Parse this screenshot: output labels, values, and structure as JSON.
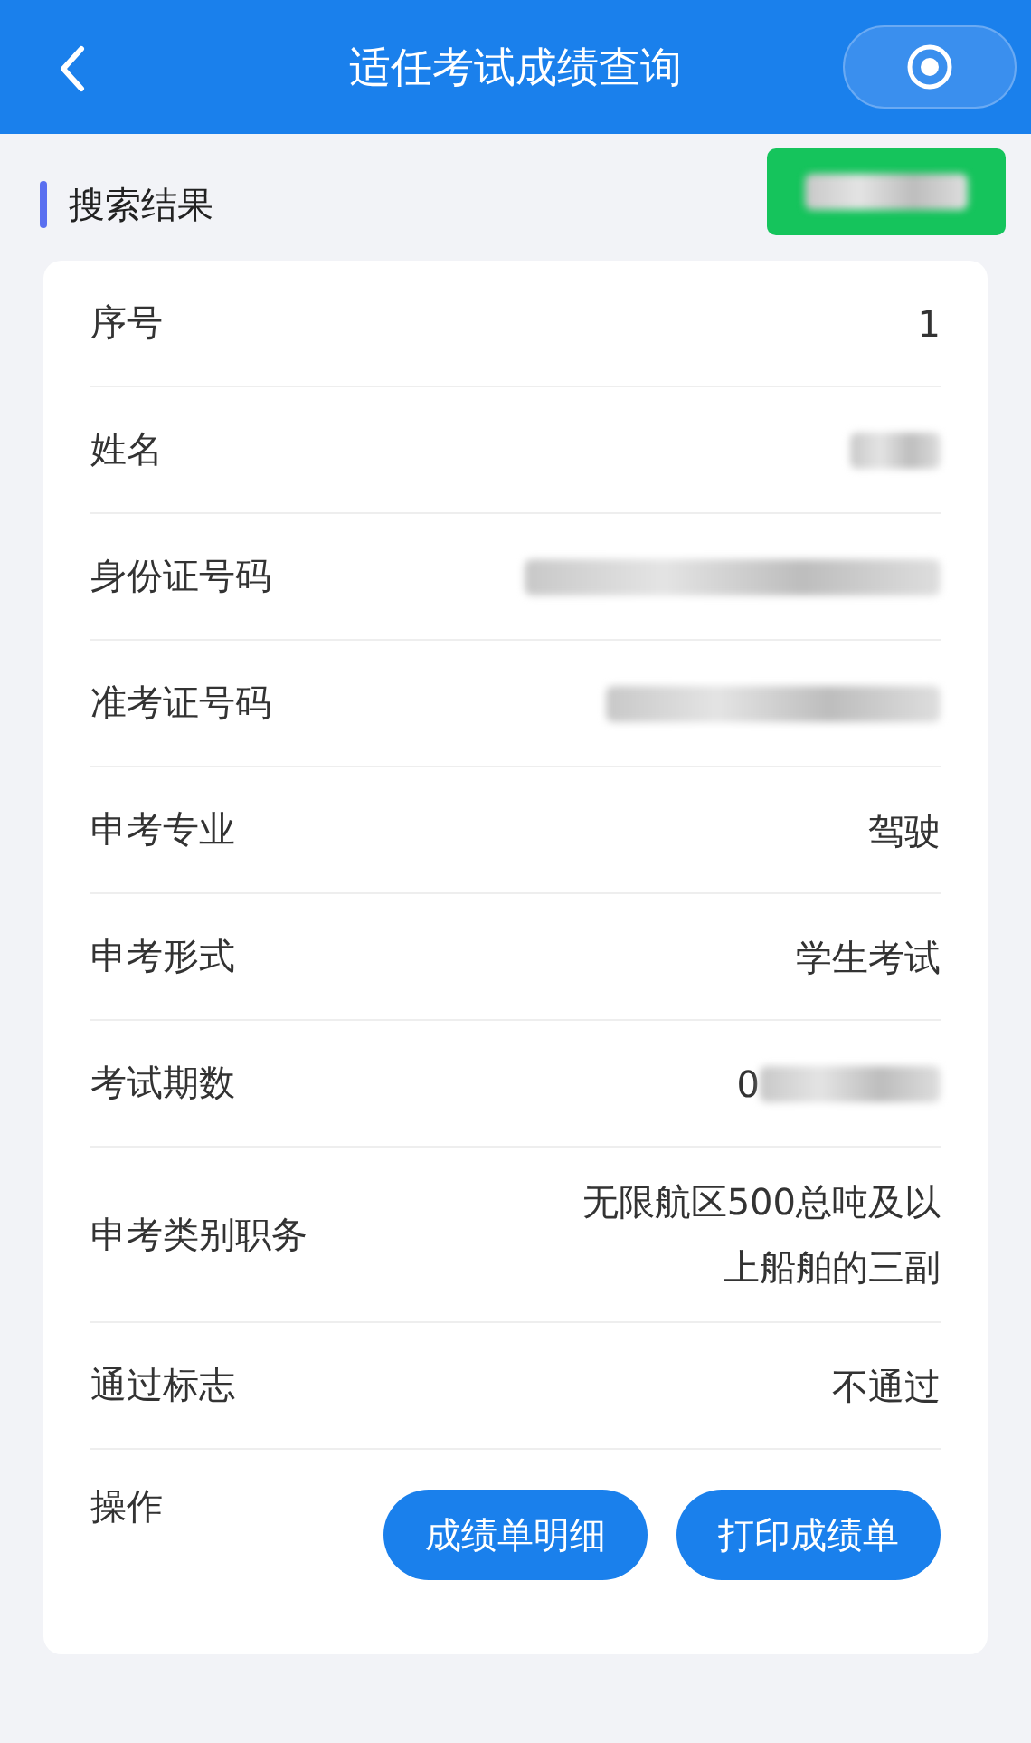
{
  "header": {
    "title": "适任考试成绩查询"
  },
  "section": {
    "title": "搜索结果"
  },
  "rows": [
    {
      "label": "序号",
      "value": "1",
      "redacted": false
    },
    {
      "label": "姓名",
      "redacted": true
    },
    {
      "label": "身份证号码",
      "redacted": true
    },
    {
      "label": "准考证号码",
      "redacted": true
    },
    {
      "label": "申考专业",
      "value": "驾驶",
      "redacted": false
    },
    {
      "label": "申考形式",
      "value": "学生考试",
      "redacted": false
    },
    {
      "label": "考试期数",
      "value": "0",
      "redacted": true
    },
    {
      "label": "申考类别职务",
      "value": "无限航区500总吨及以上船舶的三副",
      "redacted": false
    },
    {
      "label": "通过标志",
      "value": "不通过",
      "redacted": false
    }
  ],
  "actions": {
    "label": "操作",
    "buttons": [
      "成绩单明细",
      "打印成绩单"
    ]
  }
}
